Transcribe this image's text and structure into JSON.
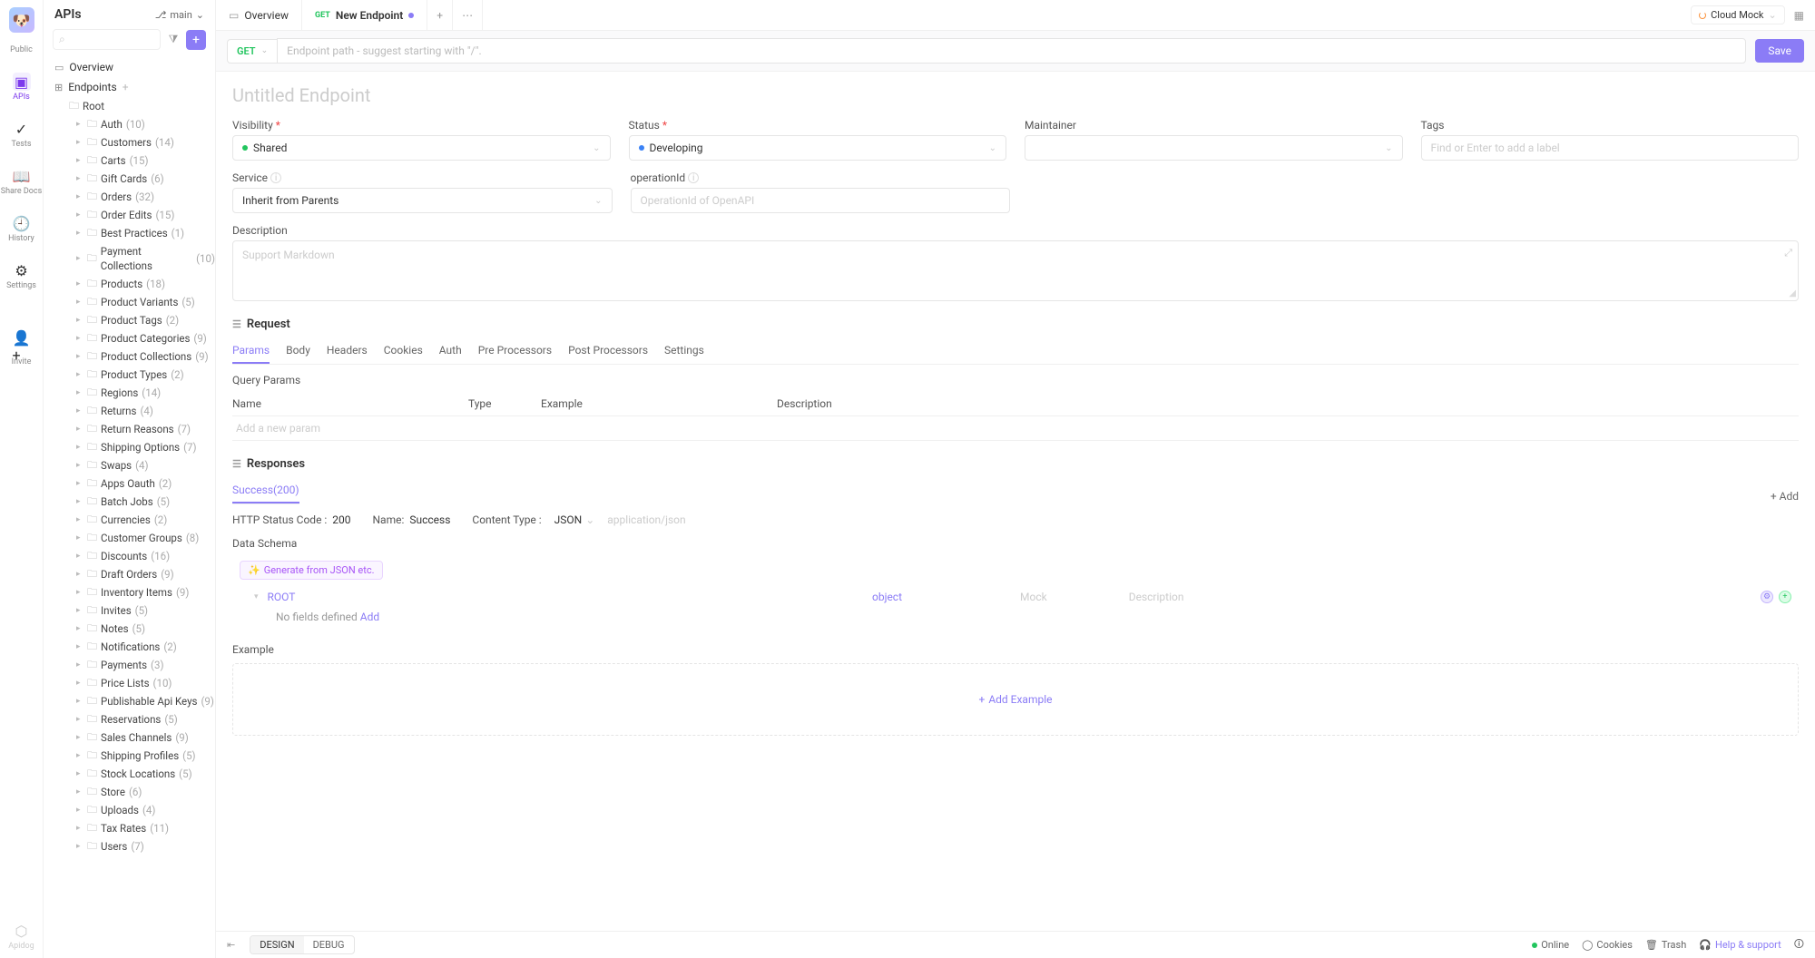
{
  "rail": {
    "logo_badge": "Public",
    "items": [
      {
        "icon": "▣",
        "label": "APIs",
        "active": true
      },
      {
        "icon": "✓",
        "label": "Tests"
      },
      {
        "icon": "📖",
        "label": "Share Docs"
      },
      {
        "icon": "🕘",
        "label": "History"
      },
      {
        "icon": "⚙",
        "label": "Settings"
      },
      {
        "icon": "👤+",
        "label": "Invite"
      }
    ],
    "bottom": {
      "icon": "⬡",
      "label": "Apidog"
    }
  },
  "sidebar": {
    "title": "APIs",
    "branch_label": "main",
    "overview_label": "Overview",
    "endpoints_label": "Endpoints",
    "root_label": "Root",
    "folders": [
      {
        "name": "Auth",
        "count": "(10)"
      },
      {
        "name": "Customers",
        "count": "(14)"
      },
      {
        "name": "Carts",
        "count": "(15)"
      },
      {
        "name": "Gift Cards",
        "count": "(6)"
      },
      {
        "name": "Orders",
        "count": "(32)"
      },
      {
        "name": "Order Edits",
        "count": "(15)"
      },
      {
        "name": "Best Practices",
        "count": "(1)"
      },
      {
        "name": "Payment Collections",
        "count": "(10)"
      },
      {
        "name": "Products",
        "count": "(18)"
      },
      {
        "name": "Product Variants",
        "count": "(5)"
      },
      {
        "name": "Product Tags",
        "count": "(2)"
      },
      {
        "name": "Product Categories",
        "count": "(9)"
      },
      {
        "name": "Product Collections",
        "count": "(9)"
      },
      {
        "name": "Product Types",
        "count": "(2)"
      },
      {
        "name": "Regions",
        "count": "(14)"
      },
      {
        "name": "Returns",
        "count": "(4)"
      },
      {
        "name": "Return Reasons",
        "count": "(7)"
      },
      {
        "name": "Shipping Options",
        "count": "(7)"
      },
      {
        "name": "Swaps",
        "count": "(4)"
      },
      {
        "name": "Apps Oauth",
        "count": "(2)"
      },
      {
        "name": "Batch Jobs",
        "count": "(5)"
      },
      {
        "name": "Currencies",
        "count": "(2)"
      },
      {
        "name": "Customer Groups",
        "count": "(8)"
      },
      {
        "name": "Discounts",
        "count": "(16)"
      },
      {
        "name": "Draft Orders",
        "count": "(9)"
      },
      {
        "name": "Inventory Items",
        "count": "(9)"
      },
      {
        "name": "Invites",
        "count": "(5)"
      },
      {
        "name": "Notes",
        "count": "(5)"
      },
      {
        "name": "Notifications",
        "count": "(2)"
      },
      {
        "name": "Payments",
        "count": "(3)"
      },
      {
        "name": "Price Lists",
        "count": "(10)"
      },
      {
        "name": "Publishable Api Keys",
        "count": "(9)"
      },
      {
        "name": "Reservations",
        "count": "(5)"
      },
      {
        "name": "Sales Channels",
        "count": "(9)"
      },
      {
        "name": "Shipping Profiles",
        "count": "(5)"
      },
      {
        "name": "Stock Locations",
        "count": "(5)"
      },
      {
        "name": "Store",
        "count": "(6)"
      },
      {
        "name": "Uploads",
        "count": "(4)"
      },
      {
        "name": "Tax Rates",
        "count": "(11)"
      },
      {
        "name": "Users",
        "count": "(7)"
      }
    ]
  },
  "tabs": {
    "overview_label": "Overview",
    "new_endpoint_method": "GET",
    "new_endpoint_label": "New Endpoint"
  },
  "top_right": {
    "cloud_mock": "Cloud Mock"
  },
  "urlbar": {
    "method": "GET",
    "placeholder": "Endpoint path - suggest starting with \"/\".",
    "save_label": "Save"
  },
  "endpoint": {
    "title": "Untitled Endpoint",
    "visibility_label": "Visibility",
    "visibility_value": "Shared",
    "status_label": "Status",
    "status_value": "Developing",
    "maintainer_label": "Maintainer",
    "tags_label": "Tags",
    "tags_placeholder": "Find or Enter to add a label",
    "service_label": "Service",
    "service_value": "Inherit from Parents",
    "operationid_label": "operationId",
    "operationid_placeholder": "OperationId of OpenAPI",
    "description_label": "Description",
    "description_placeholder": "Support Markdown"
  },
  "request": {
    "title": "Request",
    "subtabs": [
      "Params",
      "Body",
      "Headers",
      "Cookies",
      "Auth",
      "Pre Processors",
      "Post Processors",
      "Settings"
    ],
    "query_params_label": "Query Params",
    "cols": {
      "name": "Name",
      "type": "Type",
      "example": "Example",
      "description": "Description"
    },
    "add_param_placeholder": "Add a new param"
  },
  "responses": {
    "title": "Responses",
    "tab": "Success(200)",
    "add_label": "Add",
    "status_label": "HTTP Status Code :",
    "status_value": "200",
    "name_label": "Name:",
    "name_value": "Success",
    "content_type_label": "Content Type :",
    "content_type_value": "JSON",
    "content_type_mime": "application/json",
    "data_schema_label": "Data Schema",
    "generate_label": "Generate from JSON etc.",
    "root_label": "ROOT",
    "root_type": "object",
    "mock_label": "Mock",
    "desc_label": "Description",
    "empty_label": "No fields defined ",
    "add_field_label": "Add",
    "example_label": "Example",
    "add_example_label": "Add Example"
  },
  "footer": {
    "design": "DESIGN",
    "debug": "DEBUG",
    "online": "Online",
    "cookies": "Cookies",
    "trash": "Trash",
    "help": "Help & support"
  }
}
